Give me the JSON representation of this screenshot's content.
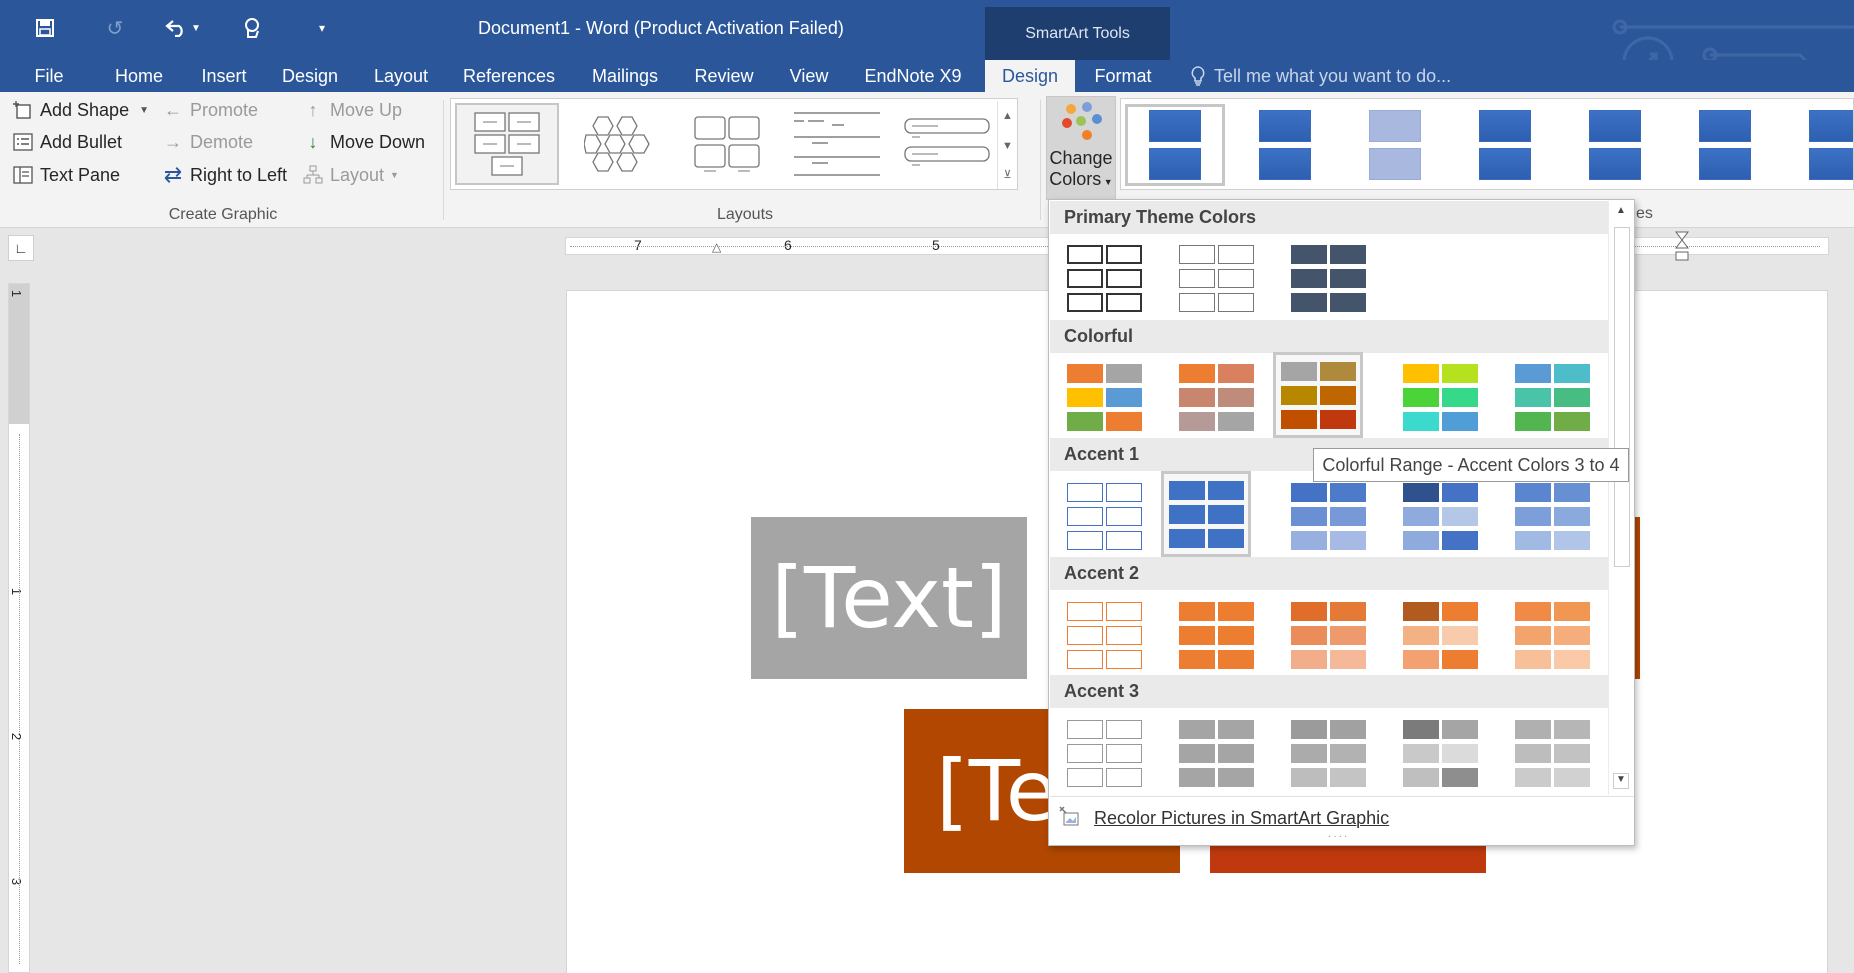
{
  "window": {
    "title": "Document1 - Word (Product Activation Failed)",
    "context_tab_group": "SmartArt Tools"
  },
  "tabs": [
    "File",
    "Home",
    "Insert",
    "Design",
    "Layout",
    "References",
    "Mailings",
    "Review",
    "View",
    "EndNote X9",
    "Design",
    "Format"
  ],
  "active_tab": "Design",
  "tell_me": "Tell me what you want to do...",
  "create_graphic": {
    "add_shape": "Add Shape",
    "add_bullet": "Add Bullet",
    "text_pane": "Text Pane",
    "promote": "Promote",
    "demote": "Demote",
    "right_to_left": "Right to Left",
    "move_up": "Move Up",
    "move_down": "Move Down",
    "layout": "Layout",
    "group_label": "Create Graphic"
  },
  "layouts": {
    "group_label": "Layouts"
  },
  "change_colors": {
    "line1": "Change",
    "line2": "Colors"
  },
  "styles_partial_label": "es",
  "ruler": {
    "numbers": [
      "7",
      "6",
      "5"
    ]
  },
  "vruler": {
    "numbers": [
      "1",
      "1",
      "2",
      "3"
    ]
  },
  "document": {
    "shape_text": "[Text]",
    "shape_text_cut": "[Te"
  },
  "colors_menu": {
    "sections": {
      "primary": "Primary Theme Colors",
      "colorful": "Colorful",
      "accent1": "Accent 1",
      "accent2": "Accent 2",
      "accent3": "Accent 3"
    },
    "tooltip": "Colorful Range - Accent Colors 3 to 4",
    "footer": "Recolor Pictures in SmartArt Graphic"
  },
  "colors": {
    "ribbon_blue": "#2b579a",
    "gray_shape": "#a5a5a5",
    "orange_shape": "#b14700",
    "red_shape": "#c0390e",
    "accent_blue": "#3f71c5"
  }
}
